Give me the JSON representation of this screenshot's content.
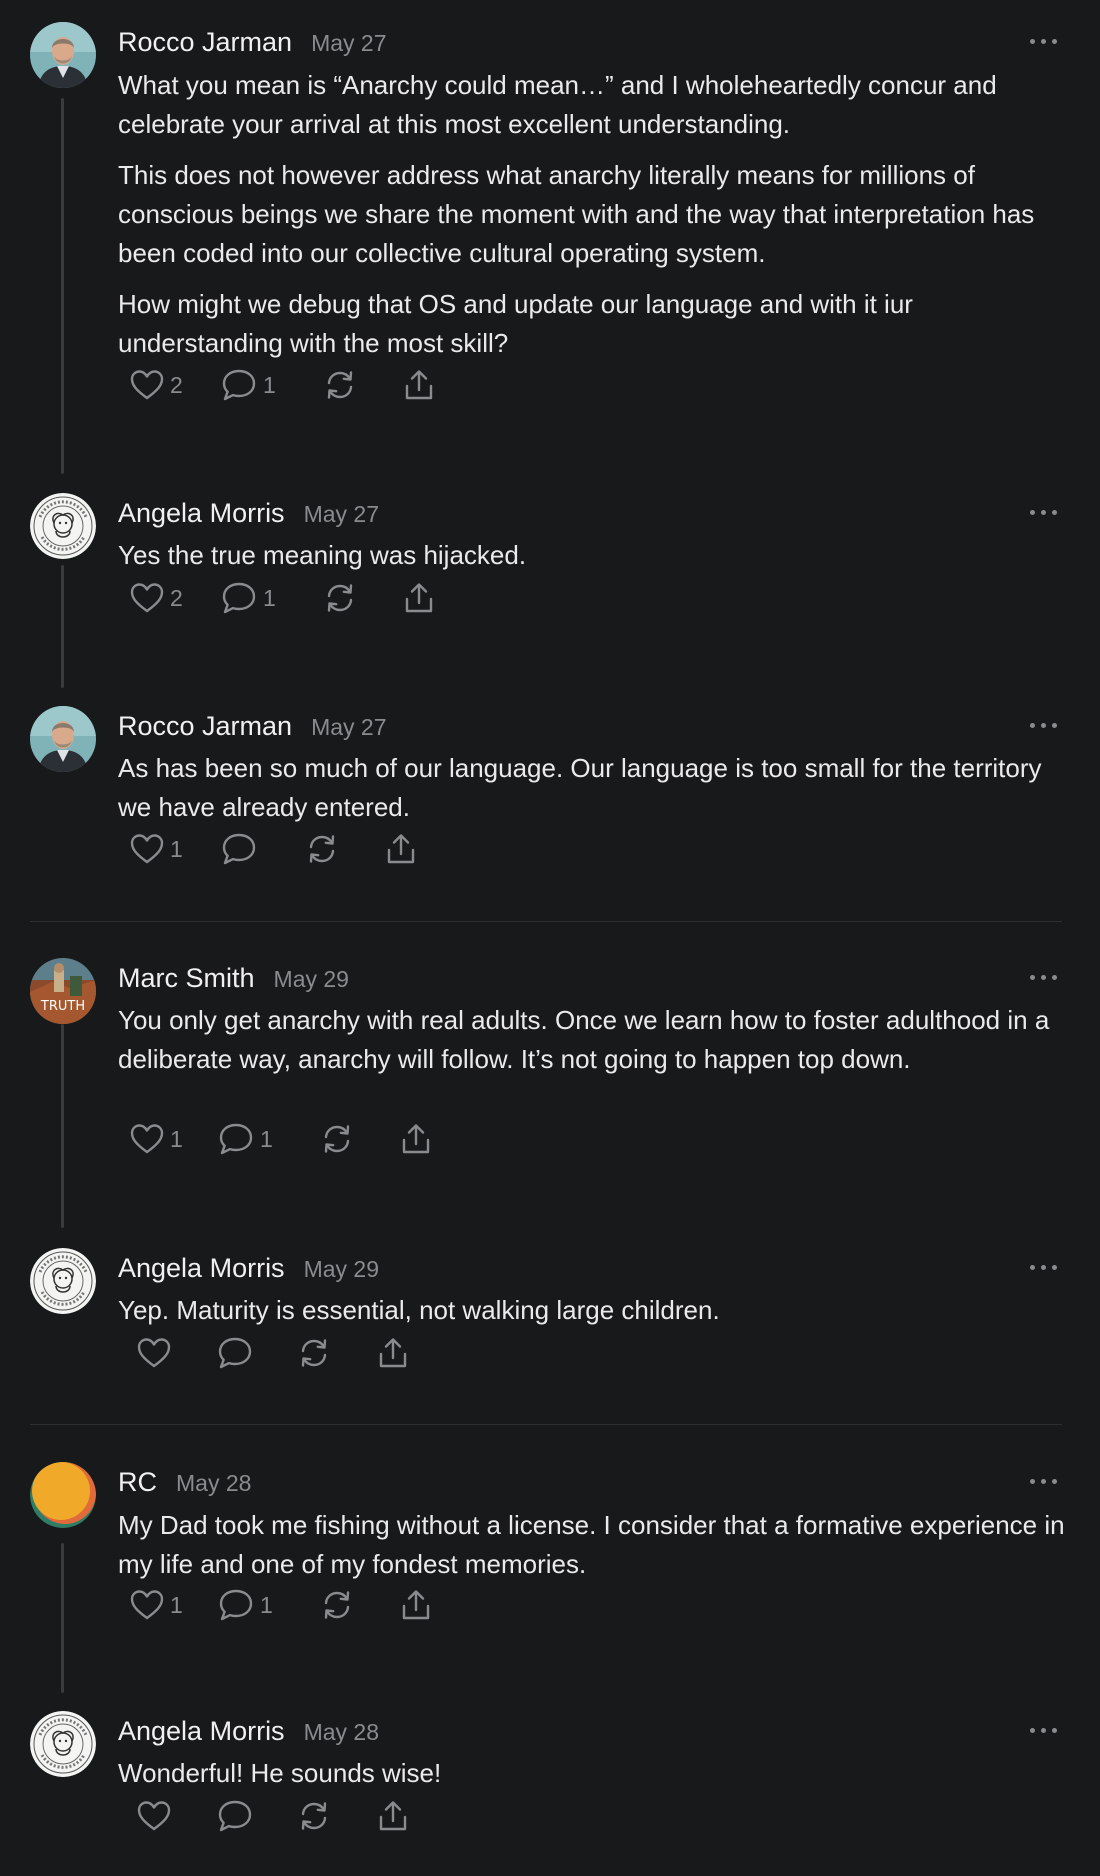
{
  "comments": [
    {
      "author": "Rocco Jarman",
      "date": "May 27",
      "avatar": "rocco-photo",
      "paragraphs": [
        "What you mean is “Anarchy could mean…” and I wholeheartedly concur and celebrate your arrival at this most excellent understanding.",
        "This does not however address what anarchy literally means for millions of conscious beings we share the moment with and the way that interpretation has been coded into our collective cultural operating system.",
        "How might we debug that OS and update our language and with it iur understanding with the most skill?"
      ],
      "likes": "2",
      "replies": "1"
    },
    {
      "author": "Angela Morris",
      "date": "May 27",
      "avatar": "angela-seal",
      "paragraphs": [
        "Yes the true meaning was hijacked."
      ],
      "likes": "2",
      "replies": "1"
    },
    {
      "author": "Rocco Jarman",
      "date": "May 27",
      "avatar": "rocco-photo",
      "paragraphs": [
        "As has been so much of our language. Our language is too small for the territory we have already entered."
      ],
      "likes": "1",
      "replies": ""
    },
    {
      "author": "Marc Smith",
      "date": "May 29",
      "avatar": "marc-photo",
      "avatar_text": "TRUTH",
      "paragraphs": [
        "You only get anarchy with real adults. Once we learn how to foster adulthood in a deliberate way, anarchy will follow. It’s not going to happen top down."
      ],
      "likes": "1",
      "replies": "1"
    },
    {
      "author": "Angela Morris",
      "date": "May 29",
      "avatar": "angela-seal",
      "paragraphs": [
        "Yep. Maturity is essential, not walking large children."
      ],
      "likes": "",
      "replies": ""
    },
    {
      "author": "RC",
      "date": "May 28",
      "avatar": "rc-gradient",
      "paragraphs": [
        "My Dad took me fishing without a license. I consider that a formative experience in my life and one of my fondest memories."
      ],
      "likes": "1",
      "replies": "1"
    },
    {
      "author": "Angela Morris",
      "date": "May 28",
      "avatar": "angela-seal",
      "paragraphs": [
        "Wonderful! He sounds wise!"
      ],
      "likes": "",
      "replies": ""
    }
  ],
  "icons": {
    "like": "heart-icon",
    "reply": "speech-bubble-icon",
    "restack": "refresh-icon",
    "share": "share-icon",
    "more": "more-dots-icon"
  },
  "colors": {
    "background": "#18191b",
    "text": "#eaeaea",
    "muted": "#8a8b8f",
    "thread_line": "#3a3b3e"
  }
}
